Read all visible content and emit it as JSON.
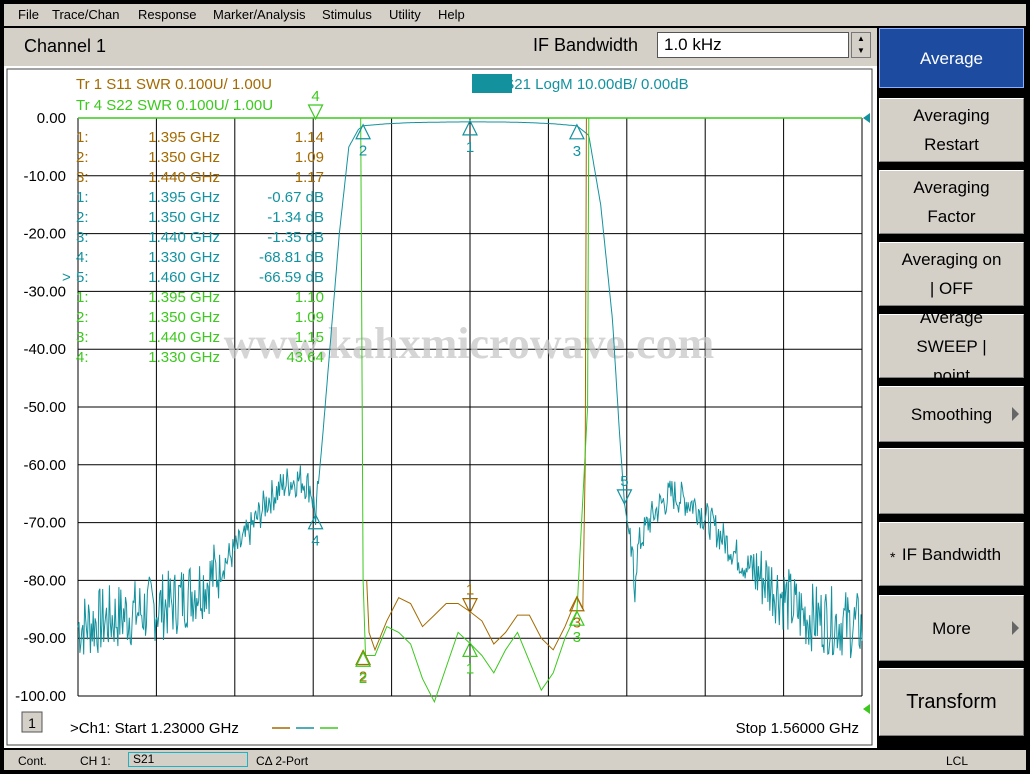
{
  "menu": [
    "File",
    "Trace/Chan",
    "Response",
    "Marker/Analysis",
    "Stimulus",
    "Utility",
    "Help"
  ],
  "channel_title": "Channel 1",
  "ifbw": {
    "label": "IF Bandwidth",
    "value": "1.0 kHz"
  },
  "softkeys": [
    {
      "label": "Average",
      "active": true
    },
    {
      "label": "Averaging Restart"
    },
    {
      "label": "Averaging Factor"
    },
    {
      "label": "Averaging on | OFF"
    },
    {
      "label": "Average SWEEP | point"
    },
    {
      "label": "Smoothing",
      "submenu": true
    },
    {
      "label": ""
    },
    {
      "label": "IF Bandwidth",
      "star": true
    },
    {
      "label": "More",
      "submenu": true
    },
    {
      "label": "Transform"
    }
  ],
  "status": {
    "mode": "Cont.",
    "channel": "CH 1:",
    "measurement": "S21",
    "cal": "CΔ 2-Port",
    "remote": "LCL"
  },
  "colors": {
    "s11": "#a36a00",
    "s21": "#13929e",
    "s22": "#3cc81e",
    "grid": "#000000",
    "background": "#ffffff"
  },
  "watermark": "www.kahxmicrowave.com",
  "chart_data": {
    "type": "line",
    "xlabel": "",
    "ylabel": "",
    "x_start_ghz": 1.23,
    "x_stop_ghz": 1.56,
    "xlim": [
      1.23,
      1.56
    ],
    "ylim": [
      -100,
      0
    ],
    "y_ticks": [
      "0.00",
      "-10.00",
      "-20.00",
      "-30.00",
      "-40.00",
      "-50.00",
      "-60.00",
      "-70.00",
      "-80.00",
      "-90.00",
      "-100.00"
    ],
    "x_divisions": 10,
    "grid": true,
    "start_label": ">Ch1: Start  1.23000 GHz",
    "stop_label": "Stop  1.56000 GHz",
    "channel_number": "1",
    "trace_headers": [
      {
        "text": "Tr  1   S11  SWR 0.100U/  1.00U",
        "color": "#a36a00"
      },
      {
        "text": "Tr  4   S22  SWR 0.100U/  1.00U",
        "color": "#3cc81e"
      },
      {
        "text": "Tr  2   S21  LogM  10.00dB/  0.00dB",
        "color": "#13929e"
      }
    ],
    "marker_table": [
      {
        "prefix": "",
        "id": "1:",
        "freq": "1.395 GHz",
        "value": "1.14",
        "color": "#a36a00"
      },
      {
        "prefix": "",
        "id": "2:",
        "freq": "1.350 GHz",
        "value": "1.09",
        "color": "#a36a00"
      },
      {
        "prefix": "",
        "id": "3:",
        "freq": "1.440 GHz",
        "value": "1.17",
        "color": "#a36a00"
      },
      {
        "prefix": "",
        "id": "1:",
        "freq": "1.395 GHz",
        "value": "-0.67 dB",
        "color": "#13929e"
      },
      {
        "prefix": "",
        "id": "2:",
        "freq": "1.350 GHz",
        "value": "-1.34 dB",
        "color": "#13929e"
      },
      {
        "prefix": "",
        "id": "3:",
        "freq": "1.440 GHz",
        "value": "-1.35 dB",
        "color": "#13929e"
      },
      {
        "prefix": "",
        "id": "4:",
        "freq": "1.330 GHz",
        "value": "-68.81 dB",
        "color": "#13929e"
      },
      {
        "prefix": ">",
        "id": "5:",
        "freq": "1.460 GHz",
        "value": "-66.59 dB",
        "color": "#13929e"
      },
      {
        "prefix": "",
        "id": "1:",
        "freq": "1.395 GHz",
        "value": "1.10",
        "color": "#3cc81e"
      },
      {
        "prefix": "",
        "id": "2:",
        "freq": "1.350 GHz",
        "value": "1.09",
        "color": "#3cc81e"
      },
      {
        "prefix": "",
        "id": "3:",
        "freq": "1.440 GHz",
        "value": "1.15",
        "color": "#3cc81e"
      },
      {
        "prefix": "",
        "id": "4:",
        "freq": "1.330 GHz",
        "value": "43.64",
        "color": "#3cc81e"
      }
    ],
    "series": [
      {
        "name": "S21",
        "unit": "dB",
        "color": "#13929e",
        "points": [
          [
            1.23,
            -88
          ],
          [
            1.25,
            -86
          ],
          [
            1.27,
            -84
          ],
          [
            1.285,
            -80
          ],
          [
            1.3,
            -73
          ],
          [
            1.31,
            -66
          ],
          [
            1.318,
            -63
          ],
          [
            1.324,
            -62.5
          ],
          [
            1.328,
            -64
          ],
          [
            1.33,
            -68.8
          ],
          [
            1.333,
            -55
          ],
          [
            1.336,
            -40
          ],
          [
            1.34,
            -20
          ],
          [
            1.344,
            -5
          ],
          [
            1.348,
            -2
          ],
          [
            1.35,
            -1.34
          ],
          [
            1.36,
            -1.0
          ],
          [
            1.37,
            -0.8
          ],
          [
            1.385,
            -0.7
          ],
          [
            1.395,
            -0.67
          ],
          [
            1.41,
            -0.7
          ],
          [
            1.42,
            -0.8
          ],
          [
            1.43,
            -1.0
          ],
          [
            1.44,
            -1.35
          ],
          [
            1.445,
            -3
          ],
          [
            1.45,
            -15
          ],
          [
            1.455,
            -35
          ],
          [
            1.458,
            -55
          ],
          [
            1.46,
            -66.6
          ],
          [
            1.462,
            -72
          ],
          [
            1.464,
            -80
          ],
          [
            1.466,
            -74
          ],
          [
            1.47,
            -70
          ],
          [
            1.475,
            -67
          ],
          [
            1.48,
            -65
          ],
          [
            1.49,
            -67
          ],
          [
            1.5,
            -72
          ],
          [
            1.51,
            -77
          ],
          [
            1.52,
            -80
          ],
          [
            1.535,
            -86
          ],
          [
            1.56,
            -88
          ]
        ]
      },
      {
        "name": "S11",
        "unit": "SWR",
        "color": "#a36a00",
        "points": [
          [
            1.3515,
            -80
          ],
          [
            1.3525,
            -89
          ],
          [
            1.355,
            -92
          ],
          [
            1.36,
            -87
          ],
          [
            1.365,
            -83
          ],
          [
            1.37,
            -84
          ],
          [
            1.375,
            -88
          ],
          [
            1.38,
            -86
          ],
          [
            1.385,
            -84
          ],
          [
            1.39,
            -84
          ],
          [
            1.395,
            -85.4
          ],
          [
            1.4,
            -87
          ],
          [
            1.405,
            -91
          ],
          [
            1.41,
            -89
          ],
          [
            1.415,
            -86
          ],
          [
            1.42,
            -86
          ],
          [
            1.425,
            -90
          ],
          [
            1.43,
            -92
          ],
          [
            1.435,
            -88
          ],
          [
            1.44,
            -83
          ],
          [
            1.4425,
            -85
          ],
          [
            1.4435,
            -60
          ],
          [
            1.444,
            0
          ]
        ]
      },
      {
        "name": "S22",
        "unit": "SWR",
        "color": "#3cc81e",
        "points": [
          [
            1.349,
            0
          ],
          [
            1.3495,
            -40
          ],
          [
            1.35,
            -80
          ],
          [
            1.351,
            -93
          ],
          [
            1.355,
            -93
          ],
          [
            1.36,
            -88
          ],
          [
            1.365,
            -89
          ],
          [
            1.37,
            -91
          ],
          [
            1.375,
            -97
          ],
          [
            1.38,
            -101
          ],
          [
            1.385,
            -95
          ],
          [
            1.39,
            -89
          ],
          [
            1.395,
            -90.9
          ],
          [
            1.4,
            -93
          ],
          [
            1.405,
            -96
          ],
          [
            1.41,
            -92
          ],
          [
            1.415,
            -89
          ],
          [
            1.42,
            -94
          ],
          [
            1.425,
            -99
          ],
          [
            1.43,
            -96
          ],
          [
            1.435,
            -90
          ],
          [
            1.44,
            -85.5
          ],
          [
            1.4445,
            -50
          ],
          [
            1.445,
            0
          ]
        ]
      }
    ],
    "markers": [
      {
        "label": "1",
        "trace": "S21",
        "x": 1.395,
        "y": -0.67,
        "dir": "up"
      },
      {
        "label": "2",
        "trace": "S21",
        "x": 1.35,
        "y": -1.34,
        "dir": "up"
      },
      {
        "label": "3",
        "trace": "S21",
        "x": 1.44,
        "y": -1.35,
        "dir": "up"
      },
      {
        "label": "4",
        "trace": "S21",
        "x": 1.33,
        "y": -68.81,
        "dir": "up"
      },
      {
        "label": "5",
        "trace": "S21",
        "x": 1.46,
        "y": -66.59,
        "dir": "down"
      },
      {
        "label": "1",
        "trace": "S11",
        "x": 1.395,
        "y": -85.4,
        "dir": "down"
      },
      {
        "label": "2",
        "trace": "S11",
        "x": 1.35,
        "y": -92.3,
        "dir": "up"
      },
      {
        "label": "3",
        "trace": "S11",
        "x": 1.44,
        "y": -83,
        "dir": "up"
      },
      {
        "label": "1",
        "trace": "S22",
        "x": 1.395,
        "y": -90.9,
        "dir": "up"
      },
      {
        "label": "2",
        "trace": "S22",
        "x": 1.35,
        "y": -92.6,
        "dir": "up"
      },
      {
        "label": "3",
        "trace": "S22",
        "x": 1.44,
        "y": -85.5,
        "dir": "up"
      },
      {
        "label": "4",
        "trace": "S22",
        "x": 1.33,
        "y": 0,
        "dir": "down"
      }
    ]
  }
}
